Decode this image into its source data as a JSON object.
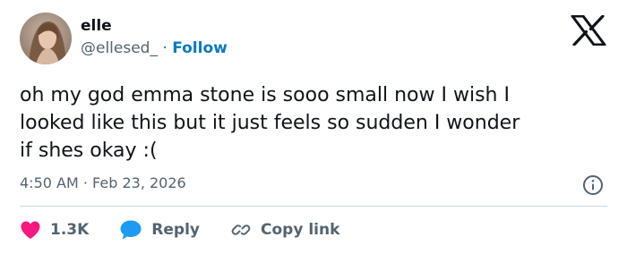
{
  "user": {
    "display_name": "elle",
    "handle": "@ellesed_",
    "separator": "·",
    "follow_label": "Follow"
  },
  "tweet": {
    "text": "oh my god emma stone is sooo small now I wish I\nlooked like this but it just feels so sudden I wonder\nif shes okay :(",
    "time": "4:50 AM",
    "meta_separator": "·",
    "date": "Feb 23, 2026"
  },
  "actions": {
    "like_count": "1.3K",
    "reply_label": "Reply",
    "copy_link_label": "Copy link"
  },
  "colors": {
    "like_heart": "#f91880",
    "reply_bubble": "#1d9bf0",
    "follow_link": "#0c7abf",
    "muted_text": "#536471",
    "divider": "#cfd9de"
  },
  "icons": {
    "brand": "x-logo-icon",
    "info": "info-icon",
    "like": "heart-icon",
    "reply": "speech-bubble-icon",
    "copy_link": "link-icon"
  }
}
